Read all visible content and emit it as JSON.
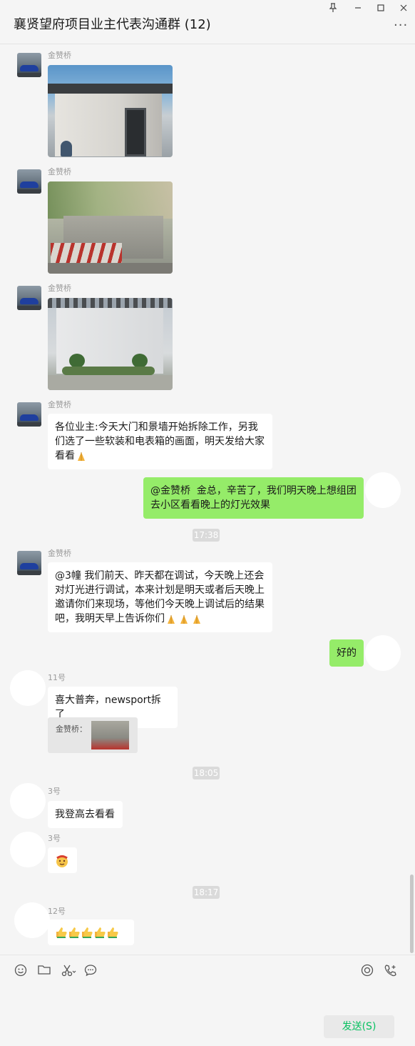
{
  "window": {
    "title": "襄贤望府项目业主代表沟通群 (12)",
    "pin_icon": "pin-icon",
    "minimize_icon": "minimize-icon",
    "maximize_icon": "maximize-icon",
    "close_icon": "close-icon",
    "more_icon": "more-icon"
  },
  "messages": {
    "m1": {
      "sender": "金赞桥",
      "type": "image"
    },
    "m2": {
      "sender": "金赞桥",
      "type": "image"
    },
    "m3": {
      "sender": "金赞桥",
      "type": "image"
    },
    "m4": {
      "sender": "金赞桥",
      "text": "各位业主:今天大门和景墙开始拆除工作，另我\n们选了一些软装和电表箱的画面，明天发给大家\n看看"
    },
    "m5": {
      "self": true,
      "text": "@金赞桥  金总，辛苦了，我们明天晚上想组团\n去小区看看晚上的灯光效果"
    },
    "time1": "17:38",
    "m6": {
      "sender": "金赞桥",
      "text": "@3幢 我们前天、昨天都在调试，今天晚上还会\n对灯光进行调试，本来计划是明天或者后天晚上\n邀请你们来现场，等他们今天晚上调试后的结果\n吧，我明天早上告诉你们"
    },
    "m7": {
      "self": true,
      "text": "好的"
    },
    "m8": {
      "sender": "11号",
      "text": "喜大普奔，newsport拆了",
      "quote_label": "金赞桥："
    },
    "time2": "18:05",
    "m9": {
      "sender": "3号",
      "text": "我登高去看看"
    },
    "m10": {
      "sender": "3号",
      "emoji": "hot-face-emoji"
    },
    "time3": "18:17",
    "m11": {
      "sender": "12号",
      "emoji": "thumbs-up-emoji"
    }
  },
  "toolbar": {
    "emoji_icon": "emoji-icon",
    "folder_icon": "folder-icon",
    "scissors_icon": "scissors-icon",
    "chat_icon": "chat-history-icon",
    "live_icon": "live-icon",
    "call_icon": "voice-call-icon",
    "send_label": "发送(S)"
  },
  "colors": {
    "self_bubble": "#95ec69",
    "other_bubble": "#ffffff",
    "send_text": "#07c160"
  }
}
